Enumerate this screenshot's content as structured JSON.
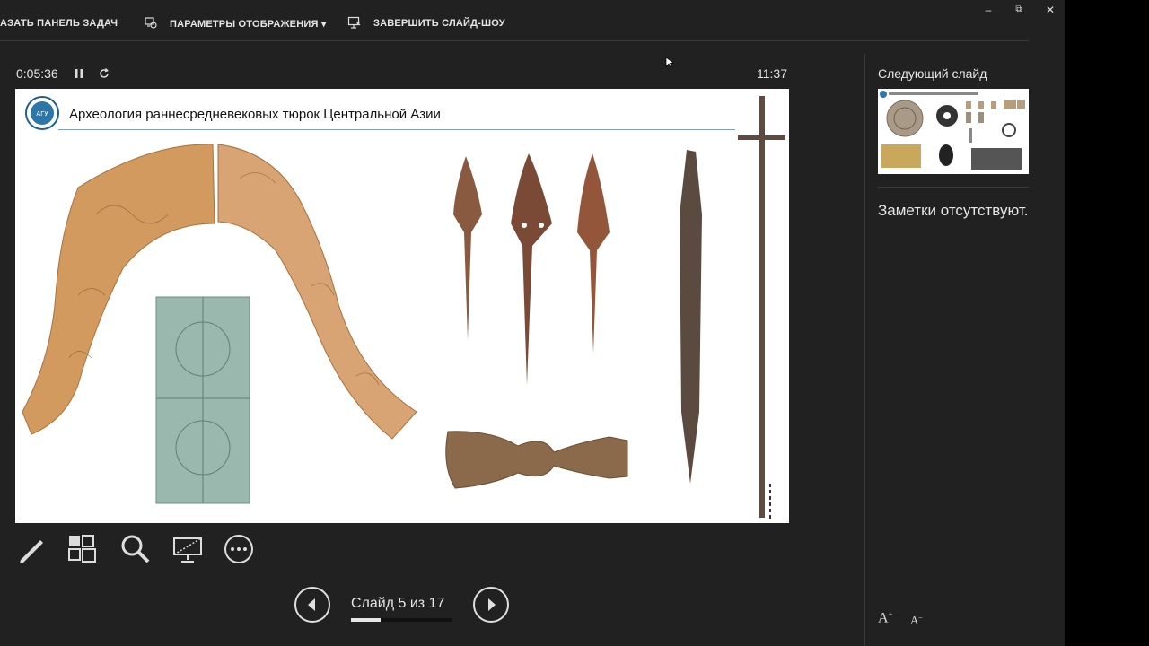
{
  "toolbar": {
    "taskbar_label": "АЗАТЬ ПАНЕЛЬ ЗАДАЧ",
    "display_settings_label": "ПАРАМЕТРЫ ОТОБРАЖЕНИЯ ▾",
    "end_show_label": "ЗАВЕРШИТЬ СЛАЙД-ШОУ",
    "minimize": "–",
    "restore": "⧉",
    "close": "✕"
  },
  "timer": {
    "elapsed": "0:05:36",
    "clock": "11:37"
  },
  "slide": {
    "title": "Археология раннесредневековых тюрок Центральной Азии",
    "logo_text": "АГУ"
  },
  "navigation": {
    "counter": "Слайд 5 из 17",
    "current": 5,
    "total": 17,
    "progress_fraction": 0.29
  },
  "next_slide": {
    "label": "Следующий слайд"
  },
  "notes": {
    "text": "Заметки отсутствуют."
  },
  "icons": {
    "pen": "pen-icon",
    "all_slides": "all-slides-icon",
    "zoom": "zoom-icon",
    "black_screen": "black-screen-icon",
    "more": "more-options-icon",
    "prev": "prev-arrow-icon",
    "next": "next-arrow-icon"
  },
  "font_controls": {
    "increase": "A",
    "decrease": "A"
  }
}
